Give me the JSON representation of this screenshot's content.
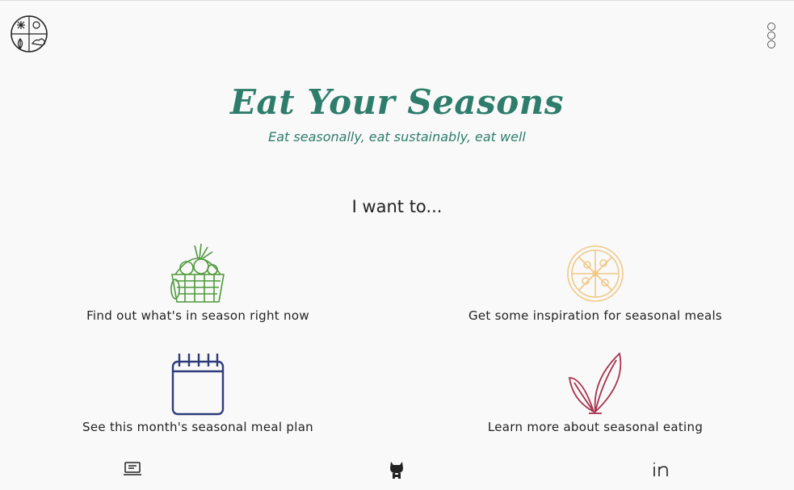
{
  "header": {
    "logo_icon": "seasons-wheel-icon",
    "menu_icon": "vertical-dots-icon"
  },
  "hero": {
    "title": "Eat Your Seasons",
    "subtitle": "Eat seasonally, eat sustainably, eat well"
  },
  "options": {
    "prompt": "I want to...",
    "items": [
      {
        "label": "Find out what's in season right now",
        "icon": "produce-basket-icon",
        "color": "#4e9a3a"
      },
      {
        "label": "Get some inspiration for seasonal meals",
        "icon": "pizza-icon",
        "color": "#f0c987"
      },
      {
        "label": "See this month's seasonal meal plan",
        "icon": "calendar-icon",
        "color": "#2e3b7a"
      },
      {
        "label": "Learn more about seasonal eating",
        "icon": "leaf-sprout-icon",
        "color": "#a8324d"
      }
    ]
  },
  "footer": {
    "links": [
      {
        "icon": "laptop-icon"
      },
      {
        "icon": "github-cat-icon"
      },
      {
        "icon": "linkedin-icon"
      }
    ]
  },
  "colors": {
    "accent": "#2e7d6b",
    "background": "#f9f9f9"
  }
}
